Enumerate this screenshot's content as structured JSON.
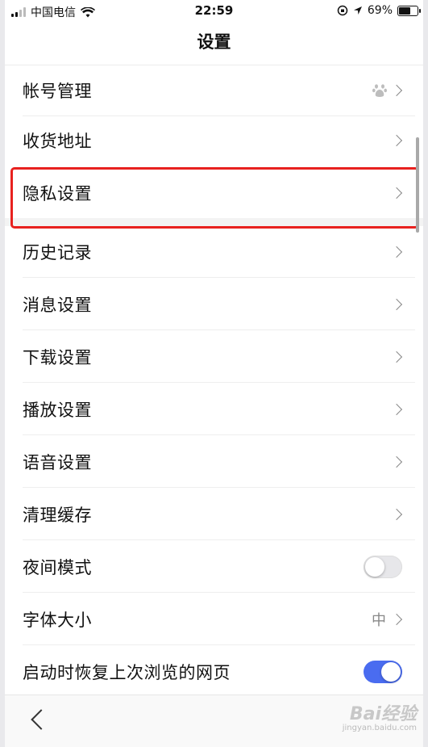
{
  "status_bar": {
    "carrier": "中国电信",
    "time": "22:59",
    "battery": "69%",
    "battery_level": 0.69
  },
  "title": "设置",
  "rows": [
    {
      "label": "帐号管理",
      "trailing": "chevron",
      "extra_icon": "paw-icon"
    },
    {
      "label": "收货地址",
      "trailing": "chevron"
    },
    {
      "label": "隐私设置",
      "trailing": "chevron",
      "highlighted": true
    },
    {
      "label": "历史记录",
      "trailing": "chevron"
    },
    {
      "label": "消息设置",
      "trailing": "chevron"
    },
    {
      "label": "下载设置",
      "trailing": "chevron"
    },
    {
      "label": "播放设置",
      "trailing": "chevron"
    },
    {
      "label": "语音设置",
      "trailing": "chevron"
    },
    {
      "label": "清理缓存",
      "trailing": "chevron"
    },
    {
      "label": "夜间模式",
      "trailing": "toggle",
      "toggle_on": false
    },
    {
      "label": "字体大小",
      "trailing": "chevron",
      "value": "中"
    },
    {
      "label": "启动时恢复上次浏览的网页",
      "trailing": "toggle",
      "toggle_on": true
    }
  ],
  "watermark": {
    "text": "Bai经验",
    "sub": "jingyan.baidu.com"
  },
  "colors": {
    "highlight": "#e8211f",
    "toggle_on": "#4a6cf0"
  }
}
